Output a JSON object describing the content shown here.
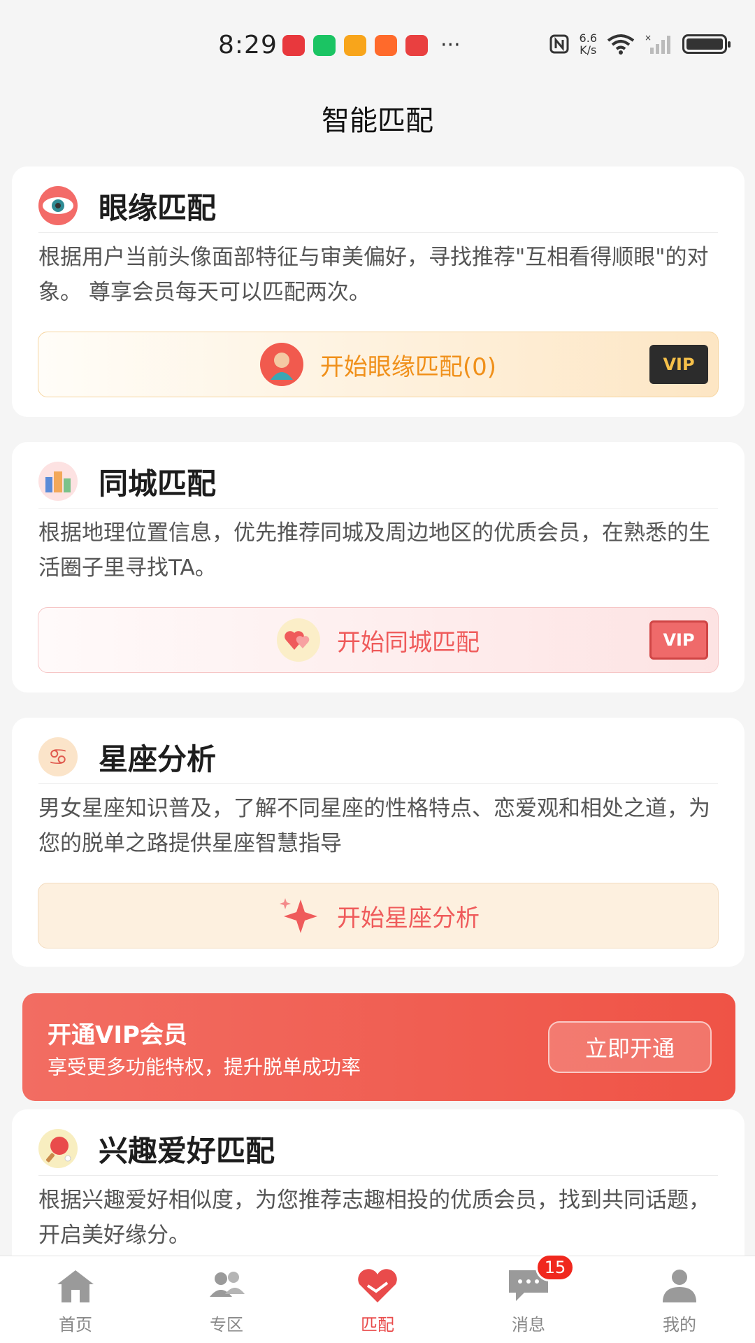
{
  "status_bar": {
    "time": "8:29",
    "speed_top": "6.6",
    "speed_bottom": "K/s",
    "dots": "···"
  },
  "page": {
    "title": "智能匹配"
  },
  "cards": [
    {
      "title": "眼缘匹配",
      "desc": "根据用户当前头像面部特征与审美偏好，寻找推荐\"互相看得顺眼\"的对象。 尊享会员每天可以匹配两次。",
      "button": "开始眼缘匹配(0)",
      "vip": "VIP"
    },
    {
      "title": "同城匹配",
      "desc": "根据地理位置信息，优先推荐同城及周边地区的优质会员，在熟悉的生活圈子里寻找TA。",
      "button": "开始同城匹配",
      "vip": "VIP"
    },
    {
      "title": "星座分析",
      "desc": "男女星座知识普及，了解不同星座的性格特点、恋爱观和相处之道，为您的脱单之路提供星座智慧指导",
      "button": "开始星座分析"
    },
    {
      "title": "兴趣爱好匹配",
      "desc": "根据兴趣爱好相似度，为您推荐志趣相投的优质会员，找到共同话题，开启美好缘分。"
    }
  ],
  "promo": {
    "title": "开通VIP会员",
    "subtitle": "享受更多功能特权，提升脱单成功率",
    "button": "立即开通"
  },
  "tabbar": {
    "items": [
      {
        "label": "首页",
        "icon": "home-icon"
      },
      {
        "label": "专区",
        "icon": "group-icon"
      },
      {
        "label": "匹配",
        "icon": "handshake-heart-icon",
        "active": true
      },
      {
        "label": "消息",
        "icon": "chat-icon",
        "badge": "15"
      },
      {
        "label": "我的",
        "icon": "profile-icon"
      }
    ]
  },
  "colors": {
    "accent": "#e94b4b",
    "orange_text": "#f0901a",
    "pink_text": "#ef5b5b",
    "promo_bg": "#ef5346"
  }
}
